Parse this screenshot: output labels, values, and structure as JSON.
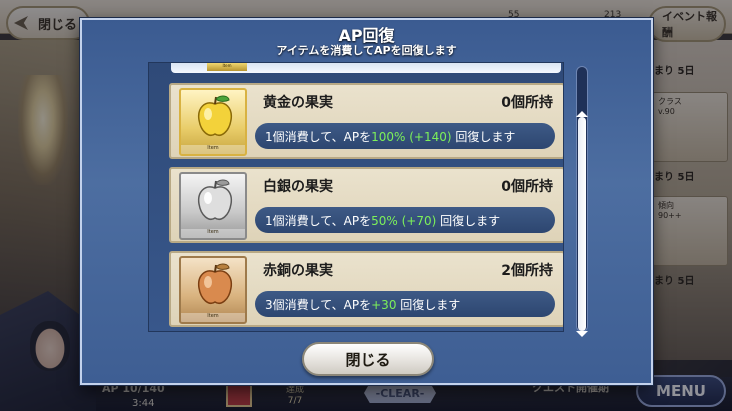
{
  "background": {
    "back_label": "閉じる",
    "top_numbers": [
      "55",
      "213"
    ],
    "event_report_label": "イベント報酬",
    "right_days": [
      "まり 5日",
      "まり 5日",
      "まり 5日"
    ],
    "right_card_lines": [
      "クラス",
      "傾向",
      "v.90",
      "90++"
    ],
    "ap_label": "AP 10/140",
    "ap_time": "3:44",
    "achieve_label": "達成",
    "achieve_count": "7/7",
    "clear_label": "-CLEAR-",
    "quest_label": "クエスト開催期",
    "menu_label": "MENU"
  },
  "modal": {
    "title": "AP回復",
    "subtitle": "アイテムを消費してAPを回復します",
    "close_label": "閉じる",
    "item_tag": "Item",
    "items": [
      {
        "name": "黄金の果実",
        "count": "0個所持",
        "desc_prefix": "1個消費して、APを",
        "desc_highlight": "100% (+140)",
        "desc_suffix": " 回復します",
        "variant": "gold"
      },
      {
        "name": "白銀の果実",
        "count": "0個所持",
        "desc_prefix": "1個消費して、APを",
        "desc_highlight": "50% (+70)",
        "desc_suffix": " 回復します",
        "variant": "silver"
      },
      {
        "name": "赤銅の果実",
        "count": "2個所持",
        "desc_prefix": "3個消費して、APを",
        "desc_highlight": "+30",
        "desc_suffix": " 回復します",
        "variant": "bronze"
      }
    ]
  },
  "colors": {
    "modal_blue": "#4d6ea1",
    "highlight_green": "#7df05a",
    "card_beige": "#eae2cd"
  }
}
